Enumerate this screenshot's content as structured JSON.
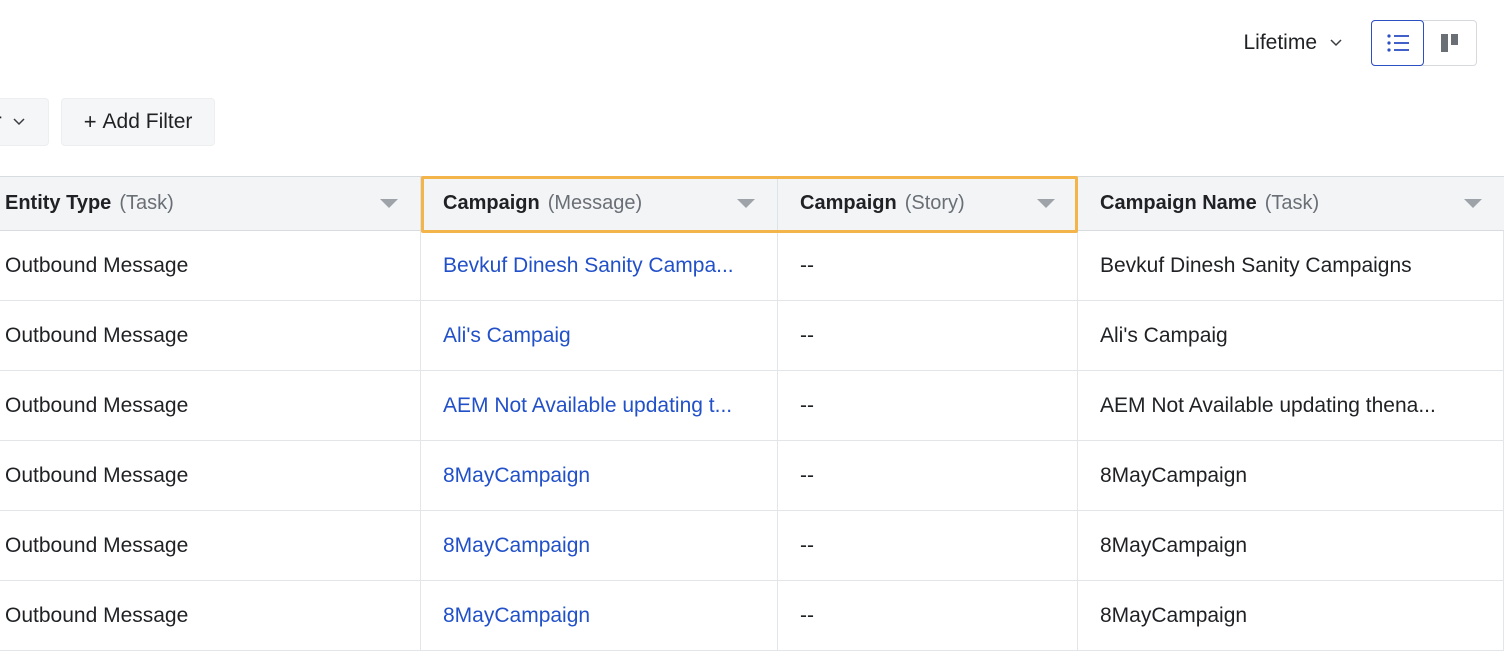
{
  "header": {
    "date_range": "Lifetime",
    "view_toggle": [
      {
        "name": "list-view",
        "icon": "list-icon",
        "active": true
      },
      {
        "name": "board-view",
        "icon": "columns-icon",
        "active": false
      }
    ]
  },
  "filters": {
    "partial_chip_label": "er",
    "add_filter_label": "Add Filter",
    "add_filter_plus": "+"
  },
  "table": {
    "columns": [
      {
        "title": "Entity Type",
        "context": "(Task)"
      },
      {
        "title": "Campaign",
        "context": "(Message)"
      },
      {
        "title": "Campaign",
        "context": "(Story)"
      },
      {
        "title": "Campaign Name",
        "context": "(Task)"
      }
    ],
    "rows": [
      {
        "entity_type": "Outbound Message",
        "campaign_message": "Bevkuf Dinesh Sanity Campa...",
        "campaign_story": "--",
        "campaign_name": "Bevkuf Dinesh Sanity Campaigns"
      },
      {
        "entity_type": "Outbound Message",
        "campaign_message": "Ali's Campaig",
        "campaign_story": "--",
        "campaign_name": "Ali's Campaig"
      },
      {
        "entity_type": "Outbound Message",
        "campaign_message": "AEM Not Available updating t...",
        "campaign_story": "--",
        "campaign_name": "AEM Not Available updating thena..."
      },
      {
        "entity_type": "Outbound Message",
        "campaign_message": "8MayCampaign",
        "campaign_story": "--",
        "campaign_name": "8MayCampaign"
      },
      {
        "entity_type": "Outbound Message",
        "campaign_message": "8MayCampaign",
        "campaign_story": "--",
        "campaign_name": "8MayCampaign"
      },
      {
        "entity_type": "Outbound Message",
        "campaign_message": "8MayCampaign",
        "campaign_story": "--",
        "campaign_name": "8MayCampaign"
      }
    ]
  },
  "colors": {
    "link": "#2150c8",
    "highlight": "#f3b54a",
    "active_toggle": "#2d4fc4",
    "header_bg": "#f3f4f6"
  }
}
